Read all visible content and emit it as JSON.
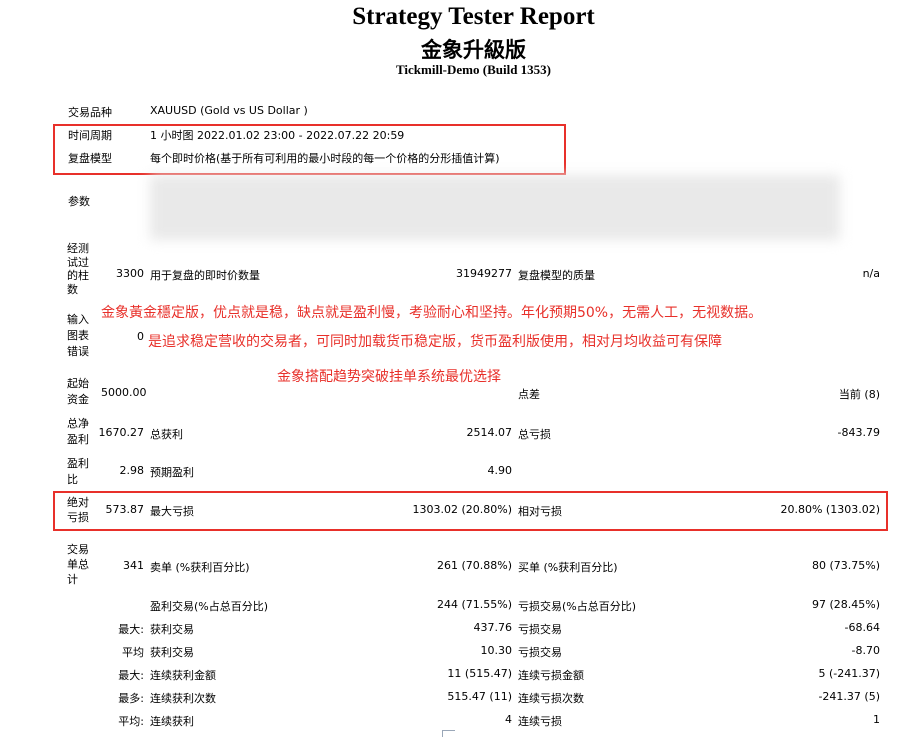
{
  "header": {
    "title": "Strategy Tester Report",
    "subtitle": "金象升級版",
    "server": "Tickmill-Demo (Build 1353)"
  },
  "info": {
    "symbol_label": "交易品种",
    "symbol_value": "XAUUSD (Gold vs US Dollar )",
    "period_label": "时间周期",
    "period_value": "1 小时图 2022.01.02 23:00 - 2022.07.22 20:59",
    "model_label": "复盘模型",
    "model_value": "每个即时价格(基于所有可利用的最小时段的每一个价格的分形插值计算)",
    "params_label": "参数"
  },
  "bars": {
    "label": "经测试过的柱数",
    "value": "3300",
    "ticks_label": "用于复盘的即时价数量",
    "ticks_value": "31949277",
    "quality_label": "复盘模型的质量",
    "quality_value": "n/a"
  },
  "errors": {
    "label": "输入图表错误",
    "value": "0"
  },
  "promo": {
    "line1": "金象黃金穩定版，优点就是稳，缺点就是盈利慢，考验耐心和坚持。年化预期50%，无需人工，无视数据。",
    "line2": "是追求稳定营收的交易者，可同时加载货币稳定版，货币盈利版使用，相对月均收益可有保障",
    "line3": "金象搭配趋势突破挂单系统最优选择"
  },
  "deposit": {
    "label": "起始资金",
    "value": "5000.00",
    "spread_label": "点差",
    "spread_value": "当前 (8)"
  },
  "profit": {
    "net_label": "总净盈利",
    "net_value": "1670.27",
    "gross_profit_label": "总获利",
    "gross_profit_value": "2514.07",
    "gross_loss_label": "总亏损",
    "gross_loss_value": "-843.79"
  },
  "factor": {
    "pf_label": "盈利比",
    "pf_value": "2.98",
    "expected_label": "预期盈利",
    "expected_value": "4.90"
  },
  "drawdown": {
    "abs_label": "绝对亏损",
    "abs_value": "573.87",
    "max_label": "最大亏损",
    "max_value": "1303.02 (20.80%)",
    "rel_label": "相对亏损",
    "rel_value": "20.80% (1303.02)"
  },
  "trades": {
    "total_label": "交易单总计",
    "total_value": "341",
    "short_label": "卖单 (%获利百分比)",
    "short_value": "261 (70.88%)",
    "long_label": "买单 (%获利百分比)",
    "long_value": "80 (73.75%)",
    "win_label": "盈利交易(%占总百分比)",
    "win_value": "244 (71.55%)",
    "loss_label": "亏损交易(%占总百分比)",
    "loss_value": "97 (28.45%)"
  },
  "stats": [
    {
      "prefix": "最大:",
      "l1": "获利交易",
      "v1": "437.76",
      "l2": "亏损交易",
      "v2": "-68.64"
    },
    {
      "prefix": "平均",
      "l1": "获利交易",
      "v1": "10.30",
      "l2": "亏损交易",
      "v2": "-8.70"
    },
    {
      "prefix": "最大:",
      "l1": "连续获利金额",
      "v1": "11 (515.47)",
      "l2": "连续亏损金额",
      "v2": "5 (-241.37)"
    },
    {
      "prefix": "最多:",
      "l1": "连续获利次数",
      "v1": "515.47 (11)",
      "l2": "连续亏损次数",
      "v2": "-241.37 (5)"
    },
    {
      "prefix": "平均:",
      "l1": "连续获利",
      "v1": "4",
      "l2": "连续亏损",
      "v2": "1"
    }
  ],
  "colors": {
    "highlight": "#e8302a"
  }
}
